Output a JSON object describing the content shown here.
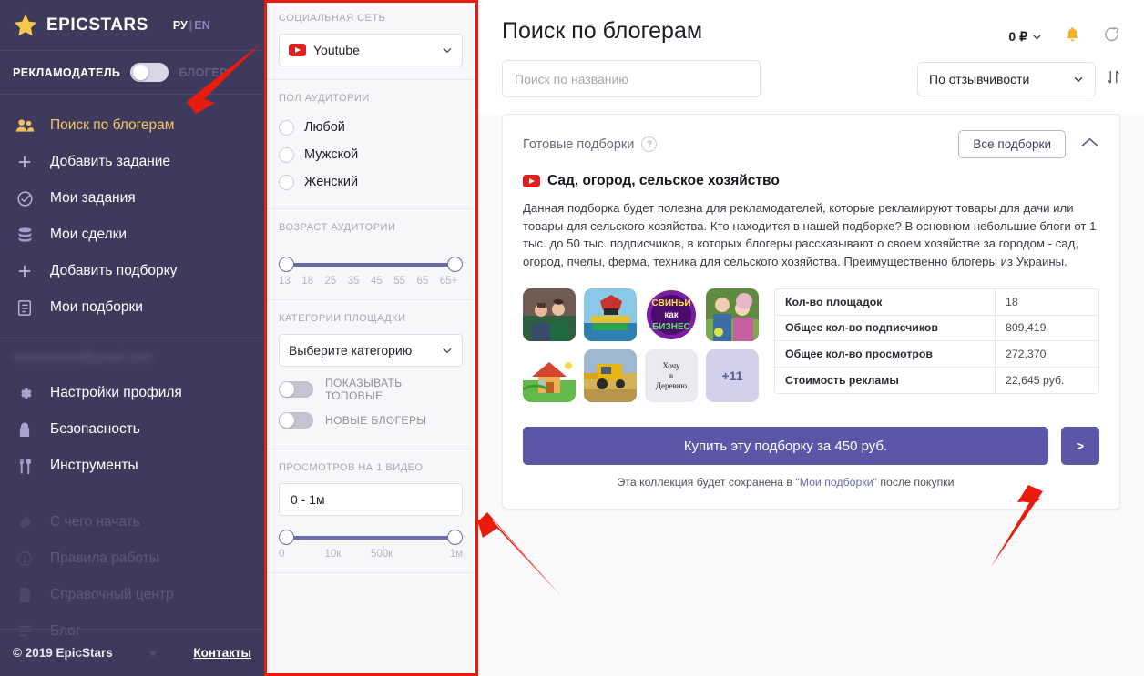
{
  "sidebar": {
    "brand": "EPICSTARS",
    "lang_ru": "РУ",
    "lang_sep": "|",
    "lang_en": "EN",
    "role_left": "РЕКЛАМОДАТЕЛЬ",
    "role_right": "БЛОГЕР",
    "email_masked": "nnnnnnnnn@gmail.com",
    "nav_primary": [
      {
        "label": "Поиск по блогерам",
        "icon": "people-icon",
        "active": true
      },
      {
        "label": "Добавить задание",
        "icon": "plus-icon",
        "active": false
      },
      {
        "label": "Мои задания",
        "icon": "check-circle-icon",
        "active": false
      },
      {
        "label": "Мои сделки",
        "icon": "coins-icon",
        "active": false
      },
      {
        "label": "Добавить подборку",
        "icon": "plus-icon",
        "active": false
      },
      {
        "label": "Мои подборки",
        "icon": "list-icon",
        "active": false
      }
    ],
    "nav_account": [
      {
        "label": "Настройки профиля",
        "icon": "gear-icon"
      },
      {
        "label": "Безопасность",
        "icon": "lock-icon"
      },
      {
        "label": "Инструменты",
        "icon": "tools-icon"
      }
    ],
    "nav_help": [
      {
        "label": "С чего начать",
        "icon": "rocket-icon"
      },
      {
        "label": "Правила работы",
        "icon": "info-icon"
      },
      {
        "label": "Справочный центр",
        "icon": "document-icon"
      },
      {
        "label": "Блог",
        "icon": "blog-icon"
      }
    ],
    "footer_copy": "© 2019 EpicStars",
    "footer_contacts": "Контакты"
  },
  "filters": {
    "social_label": "СОЦИАЛЬНАЯ СЕТЬ",
    "social_value": "Youtube",
    "gender_label": "ПОЛ АУДИТОРИИ",
    "gender_options": [
      "Любой",
      "Мужской",
      "Женский"
    ],
    "age_label": "ВОЗРАСТ АУДИТОРИИ",
    "age_ticks": [
      "13",
      "18",
      "25",
      "35",
      "45",
      "55",
      "65",
      "65+"
    ],
    "category_label": "КАТЕГОРИИ ПЛОЩАДКИ",
    "category_value": "Выберите категорию",
    "toggle_top": "ПОКАЗЫВАТЬ ТОПОВЫЕ",
    "toggle_new": "НОВЫЕ БЛОГЕРЫ",
    "views_label": "ПРОСМОТРОВ НА 1 ВИДЕО",
    "views_value": "0 - 1м",
    "views_ticks": [
      "0",
      "10к",
      "500к",
      "1м"
    ]
  },
  "header": {
    "title": "Поиск по блогерам",
    "balance": "0 ₽",
    "search_placeholder": "Поиск по названию",
    "search_value": "",
    "sort_value": "По отзывчивости"
  },
  "collection_card": {
    "section_title": "Готовые подборки",
    "help_glyph": "?",
    "all_button": "Все подборки",
    "title": "Сад, огород, сельское хозяйство",
    "description": "Данная подборка будет полезна для рекламодателей, которые рекламируют товары для дачи или товары для сельского хозяйства. Кто находится в нашей подборке? В основном небольшие блоги от 1 тыс. до 50 тыс. подписчиков, в которых блогеры рассказывают о своем хозяйстве за городом - сад, огород, пчелы, ферма, техника для сельского хозяйства. Преимущественно блогеры из Украины.",
    "thumbnails": [
      {
        "name": "blogger-couple-photo",
        "kind": "photo",
        "text": ""
      },
      {
        "name": "semya-kravchenko-logo",
        "kind": "photo",
        "text": ""
      },
      {
        "name": "svinyi-kak-biznes-logo",
        "kind": "photo",
        "text": ""
      },
      {
        "name": "garden-family-photo",
        "kind": "photo",
        "text": ""
      },
      {
        "name": "house-illustration",
        "kind": "photo",
        "text": ""
      },
      {
        "name": "combine-harvester-photo",
        "kind": "photo",
        "text": ""
      },
      {
        "name": "hochu-v-derevnyu-logo",
        "kind": "text",
        "text": "Хочу\nв\nДеревню"
      },
      {
        "name": "more-count",
        "kind": "more",
        "text": "+11"
      }
    ],
    "stats": [
      {
        "key": "Кол-во площадок",
        "value": "18"
      },
      {
        "key": "Общее кол-во подписчиков",
        "value": "809,419"
      },
      {
        "key": "Общее кол-во просмотров",
        "value": "272,370"
      },
      {
        "key": "Стоимость рекламы",
        "value": "22,645 руб."
      }
    ],
    "buy_label": "Купить эту подборку за 450 руб.",
    "next_label": ">",
    "note_before": "Эта коллекция будет сохранена в ",
    "note_highlight": "\"Мои подборки\"",
    "note_after": " после покупки"
  },
  "colors": {
    "sidebar_bg": "#3e3a5c",
    "accent_yellow": "#f5c563",
    "primary_purple": "#5a57a8",
    "slider_purple": "#6c6aab",
    "annotation_red": "#e81b0d",
    "youtube_red": "#e02020"
  }
}
